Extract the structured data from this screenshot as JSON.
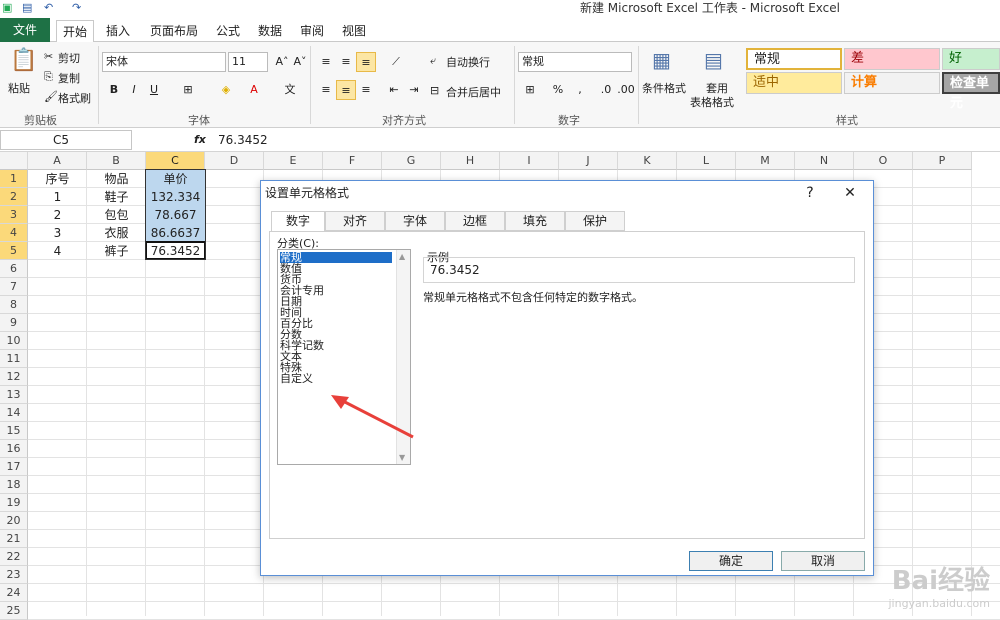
{
  "window": {
    "title": "新建 Microsoft Excel 工作表 - Microsoft Excel"
  },
  "tabs": [
    "文件",
    "开始",
    "插入",
    "页面布局",
    "公式",
    "数据",
    "审阅",
    "视图"
  ],
  "ribbon": {
    "clipboard": {
      "paste": "粘贴",
      "cut": "剪切",
      "copy": "复制",
      "painter": "格式刷",
      "label": "剪贴板"
    },
    "font": {
      "name": "宋体",
      "size": "11",
      "label": "字体"
    },
    "align": {
      "wrap": "自动换行",
      "merge": "合并后居中",
      "label": "对齐方式"
    },
    "number": {
      "format": "常规",
      "percent": "%",
      "label": "数字"
    },
    "styles": {
      "cond": "条件格式",
      "table": "套用",
      "table2": "表格格式",
      "label": "样式",
      "s1": "常规",
      "s2": "差",
      "s3": "好",
      "s4": "适中",
      "s5": "计算",
      "s6": "检查单元"
    }
  },
  "formula_bar": {
    "namebox": "C5",
    "fx": "fx",
    "value": "76.3452"
  },
  "columns": [
    "A",
    "B",
    "C",
    "D",
    "E",
    "F",
    "G",
    "H",
    "I",
    "J",
    "K",
    "L",
    "M",
    "N",
    "O",
    "P"
  ],
  "rows": [
    "1",
    "2",
    "3",
    "4",
    "5",
    "6",
    "7",
    "8",
    "9",
    "10",
    "11",
    "12",
    "13",
    "14",
    "15",
    "16",
    "17",
    "18",
    "19",
    "20",
    "21",
    "22",
    "23",
    "24",
    "25"
  ],
  "cells": [
    [
      "序号",
      "物品",
      "单价"
    ],
    [
      "1",
      "鞋子",
      "132.334"
    ],
    [
      "2",
      "包包",
      "78.667"
    ],
    [
      "3",
      "衣服",
      "86.6637"
    ],
    [
      "4",
      "裤子",
      "76.3452"
    ]
  ],
  "dialog": {
    "title": "设置单元格格式",
    "help": "?",
    "close": "✕",
    "tabs": [
      "数字",
      "对齐",
      "字体",
      "边框",
      "填充",
      "保护"
    ],
    "category_label": "分类(C):",
    "categories": [
      "常规",
      "数值",
      "货币",
      "会计专用",
      "日期",
      "时间",
      "百分比",
      "分数",
      "科学记数",
      "文本",
      "特殊",
      "自定义"
    ],
    "sample_label": "示例",
    "sample_value": "76.3452",
    "description": "常规单元格格式不包含任何特定的数字格式。",
    "ok": "确定",
    "cancel": "取消"
  },
  "watermark": {
    "line1": "Bai经验",
    "line2": "jingyan.baidu.com"
  },
  "colors": {
    "file_tab": "#1e7145",
    "selection": "#bdd7ee",
    "header_sel": "#fbd97a",
    "arrow": "#e8403a"
  }
}
